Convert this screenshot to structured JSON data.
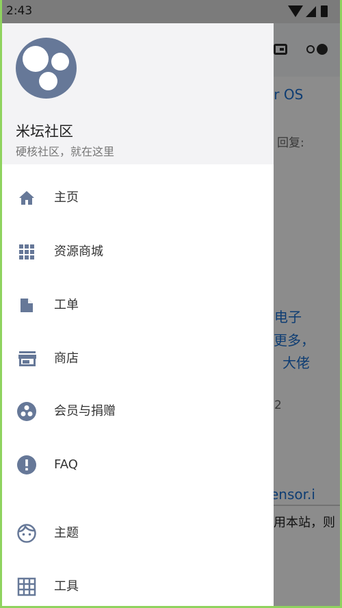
{
  "status_bar": {
    "time": "2:43"
  },
  "drawer": {
    "site_name": "米坛社区",
    "slogan": "硬核社区，就在这里",
    "items": [
      {
        "label": "主页",
        "icon": "home-icon"
      },
      {
        "label": "资源商城",
        "icon": "apps-grid-icon"
      },
      {
        "label": "工单",
        "icon": "document-icon"
      },
      {
        "label": "商店",
        "icon": "store-icon"
      },
      {
        "label": "会员与捐赠",
        "icon": "membership-icon"
      },
      {
        "label": "FAQ",
        "icon": "exclamation-icon"
      },
      {
        "label": "主题",
        "icon": "face-icon"
      },
      {
        "label": "工具",
        "icon": "table-grid-icon"
      }
    ]
  },
  "background": {
    "os_text": "er OS",
    "reply_text": "回复:",
    "link_line1": "电子",
    "link_line2": "更多，",
    "link_line3": "大佬",
    "number_text": "2",
    "sensor_text": "ensor.i",
    "notice_text": "用本站，则"
  },
  "colors": {
    "accent": "#667898",
    "link": "#1a6fd1"
  }
}
